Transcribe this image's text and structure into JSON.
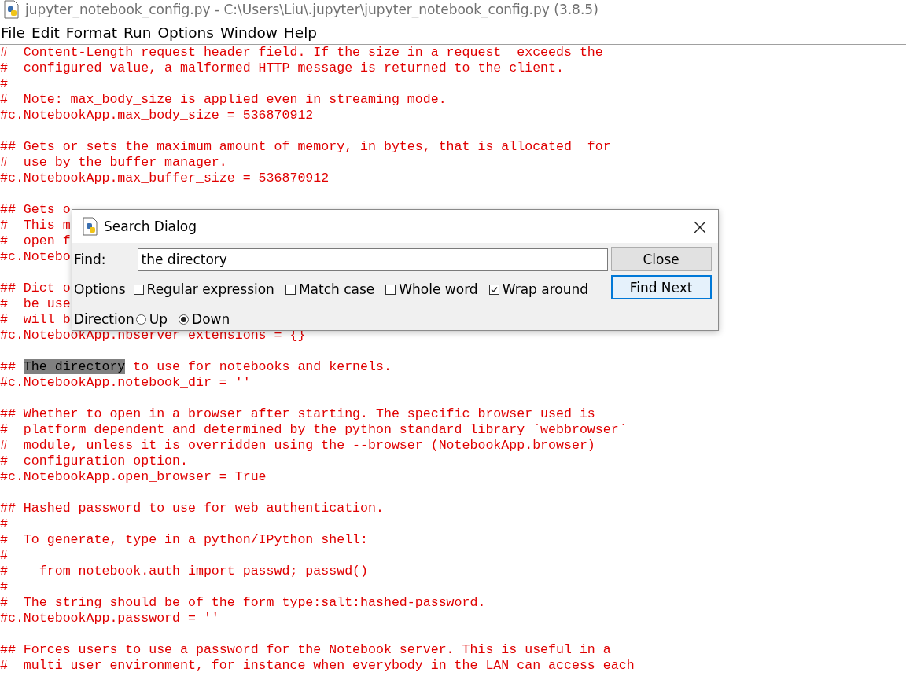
{
  "window": {
    "title": "jupyter_notebook_config.py - C:\\Users\\Liu\\.jupyter\\jupyter_notebook_config.py (3.8.5)"
  },
  "menu": [
    {
      "key": "F",
      "after": "ile"
    },
    {
      "key": "E",
      "after": "dit"
    },
    {
      "before": "F",
      "key": "o",
      "after": "rmat"
    },
    {
      "key": "R",
      "after": "un"
    },
    {
      "key": "O",
      "after": "ptions"
    },
    {
      "key": "W",
      "after": "indow"
    },
    {
      "key": "H",
      "after": "elp"
    }
  ],
  "editor": {
    "lines": [
      {
        "kind": "text",
        "text": "#  Content-Length request header field. If the size in a request  exceeds the"
      },
      {
        "kind": "text",
        "text": "#  configured value, a malformed HTTP message is returned to the client."
      },
      {
        "kind": "text",
        "text": "#"
      },
      {
        "kind": "text",
        "text": "#  Note: max_body_size is applied even in streaming mode."
      },
      {
        "kind": "text",
        "text": "#c.NotebookApp.max_body_size = 536870912"
      },
      {
        "kind": "blank"
      },
      {
        "kind": "text",
        "text": "## Gets or sets the maximum amount of memory, in bytes, that is allocated  for"
      },
      {
        "kind": "text",
        "text": "#  use by the buffer manager."
      },
      {
        "kind": "text",
        "text": "#c.NotebookApp.max_buffer_size = 536870912"
      },
      {
        "kind": "blank"
      },
      {
        "kind": "text",
        "text": "## Gets o"
      },
      {
        "kind": "text",
        "text": "#  This m"
      },
      {
        "kind": "text",
        "text": "#  open f"
      },
      {
        "kind": "text",
        "text": "#c.Notebo"
      },
      {
        "kind": "blank"
      },
      {
        "kind": "text",
        "text": "## Dict o"
      },
      {
        "kind": "text",
        "text": "#  be use"
      },
      {
        "kind": "text",
        "text": "#  will b"
      },
      {
        "kind": "text",
        "text": "#c.NotebookApp.nbserver_extensions = {}"
      },
      {
        "kind": "blank"
      },
      {
        "kind": "parts",
        "parts": [
          {
            "text": "## ",
            "highlighted": false
          },
          {
            "text": "The directory",
            "highlighted": true
          },
          {
            "text": " to use for notebooks and kernels.",
            "highlighted": false
          }
        ]
      },
      {
        "kind": "text",
        "text": "#c.NotebookApp.notebook_dir = ''"
      },
      {
        "kind": "blank"
      },
      {
        "kind": "text",
        "text": "## Whether to open in a browser after starting. The specific browser used is"
      },
      {
        "kind": "text",
        "text": "#  platform dependent and determined by the python standard library `webbrowser`"
      },
      {
        "kind": "text",
        "text": "#  module, unless it is overridden using the --browser (NotebookApp.browser)"
      },
      {
        "kind": "text",
        "text": "#  configuration option."
      },
      {
        "kind": "text",
        "text": "#c.NotebookApp.open_browser = True"
      },
      {
        "kind": "blank"
      },
      {
        "kind": "text",
        "text": "## Hashed password to use for web authentication."
      },
      {
        "kind": "text",
        "text": "#"
      },
      {
        "kind": "text",
        "text": "#  To generate, type in a python/IPython shell:"
      },
      {
        "kind": "text",
        "text": "#"
      },
      {
        "kind": "text",
        "text": "#    from notebook.auth import passwd; passwd()"
      },
      {
        "kind": "text",
        "text": "#"
      },
      {
        "kind": "text",
        "text": "#  The string should be of the form type:salt:hashed-password."
      },
      {
        "kind": "text",
        "text": "#c.NotebookApp.password = ''"
      },
      {
        "kind": "blank"
      },
      {
        "kind": "text",
        "text": "## Forces users to use a password for the Notebook server. This is useful in a"
      },
      {
        "kind": "text",
        "text": "#  multi user environment, for instance when everybody in the LAN can access each"
      }
    ]
  },
  "dialog": {
    "title": "Search Dialog",
    "close_glyph": "×",
    "find": {
      "label": "Find:",
      "value": "the directory"
    },
    "options": {
      "label": "Options",
      "items": [
        {
          "label": "Regular expression",
          "checked": false
        },
        {
          "label": "Match case",
          "checked": false
        },
        {
          "label": "Whole word",
          "checked": false
        },
        {
          "label": "Wrap around",
          "checked": true
        }
      ]
    },
    "direction": {
      "label": "Direction",
      "items": [
        {
          "label": "Up",
          "selected": false
        },
        {
          "label": "Down",
          "selected": true
        }
      ]
    },
    "buttons": [
      {
        "label": "Close",
        "focused": false
      },
      {
        "label": "Find Next",
        "focused": true
      }
    ]
  }
}
